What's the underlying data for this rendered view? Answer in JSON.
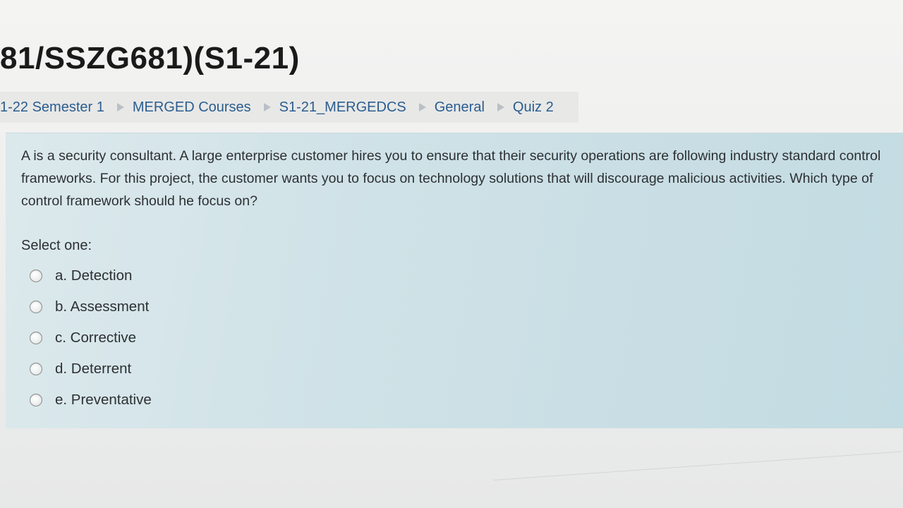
{
  "page": {
    "title": "81/SSZG681)(S1-21)"
  },
  "breadcrumb": {
    "items": [
      {
        "label": "1-22 Semester 1"
      },
      {
        "label": "MERGED Courses"
      },
      {
        "label": "S1-21_MERGEDCS"
      },
      {
        "label": "General"
      },
      {
        "label": "Quiz 2"
      }
    ]
  },
  "question": {
    "text": "A is a security consultant. A large enterprise customer hires you to ensure that their security operations are following industry standard control frameworks. For this project, the customer wants you to focus on technology solutions that will discourage malicious activities. Which type of control framework should he focus on?",
    "prompt": "Select one:",
    "answers": [
      {
        "label": "a. Detection"
      },
      {
        "label": "b. Assessment"
      },
      {
        "label": "c. Corrective"
      },
      {
        "label": "d. Deterrent"
      },
      {
        "label": "e. Preventative"
      }
    ]
  },
  "colors": {
    "link": "#2a5d8f",
    "question_bg": "#cfe2e7"
  }
}
